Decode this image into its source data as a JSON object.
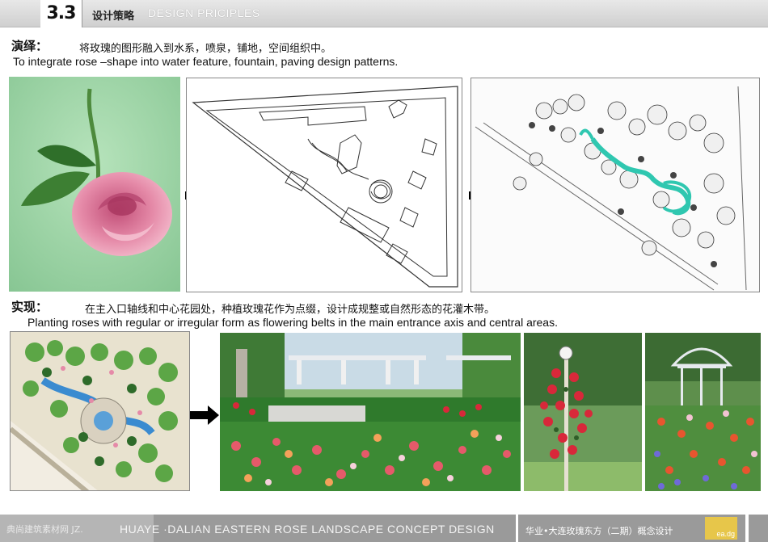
{
  "header": {
    "section_number": "3.3",
    "title_cn": "设计策略",
    "title_en": "DESIGN PRICIPLES"
  },
  "interpretation": {
    "label_cn": "演绎：",
    "text_cn": "将玫瑰的图形融入到水系，喷泉，铺地，空间组织中。",
    "text_en": "To integrate rose –shape into water feature, fountain, paving design patterns."
  },
  "implementation": {
    "label_cn": "实现：",
    "text_cn": "在主入口轴线和中心花园处，种植玫瑰花作为点缀，设计成规整或自然形态的花灌木带。",
    "text_en": "Planting roses with regular or irregular form as flowering belts in the main entrance axis and central areas."
  },
  "footer": {
    "watermark": "典尚建筑素材网 JZ.",
    "project_en": "HUAYE ·DALIAN EASTERN ROSE LANDSCAPE CONCEPT DESIGN",
    "project_cn": "华业•大连玫瑰东方（二期）概念设计",
    "logo_text": "ea.dg"
  },
  "colors": {
    "rose_green_bg": "#9ed3a6",
    "rose_pink": "#e58aa8",
    "water_teal": "#2fc7b0",
    "garden_green": "#3f8f3a",
    "flower_red": "#d8283a",
    "logo_yellow": "#e7c64a"
  },
  "icons": {
    "arrow": "right-arrow-icon"
  }
}
